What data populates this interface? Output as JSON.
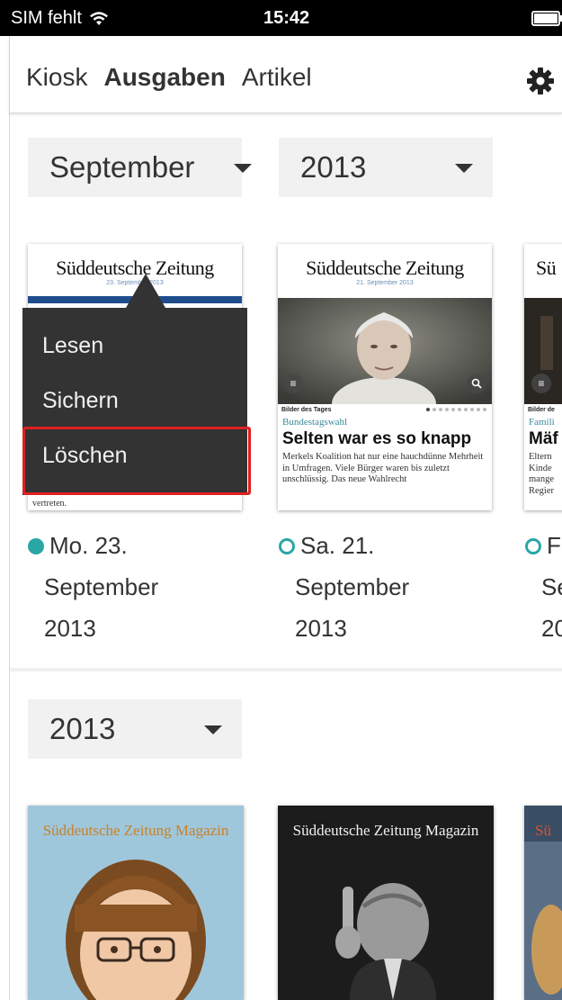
{
  "status_bar": {
    "carrier": "SIM fehlt",
    "time": "15:42"
  },
  "nav": {
    "tabs": [
      {
        "label": "Kiosk",
        "active": false
      },
      {
        "label": "Ausgaben",
        "active": true
      },
      {
        "label": "Artikel",
        "active": false
      }
    ]
  },
  "filters": {
    "month": "September",
    "year": "2013"
  },
  "issues": [
    {
      "masthead": "Süddeutsche Zeitung",
      "date_line": "23. September 2013",
      "weekday_date": "Mo. 23.",
      "month": "September",
      "year": "2013",
      "downloaded": true,
      "visible_text": "vertreten."
    },
    {
      "masthead": "Süddeutsche Zeitung",
      "date_line": "21. September 2013",
      "photo_section": "Bilder des Tages",
      "kicker": "Bundestagswahl",
      "headline": "Selten war es so knapp",
      "body": "Merkels Koalition hat nur eine hauchdünne Mehrheit in Umfragen. Viele Bürger waren bis zuletzt unschlüssig. Das neue Wahlrecht",
      "weekday_date": "Sa. 21.",
      "month": "September",
      "year": "2013",
      "downloaded": false
    },
    {
      "masthead": "Sü",
      "photo_section": "Bilder de",
      "kicker": "Famili",
      "headline": "Mäf",
      "body_lines": [
        "Eltern",
        "Kinde",
        "mange",
        "Regier"
      ],
      "weekday_date": "F",
      "month": "Se",
      "year": "20",
      "downloaded": false
    }
  ],
  "context_menu": {
    "items": [
      "Lesen",
      "Sichern",
      "Löschen"
    ],
    "highlighted": "Löschen"
  },
  "magazine_filter": {
    "year": "2013"
  },
  "magazines": [
    {
      "title": "Süddeutsche Zeitung Magazin"
    },
    {
      "title": "Süddeutsche Zeitung Magazin"
    },
    {
      "title": "Sü"
    }
  ],
  "colors": {
    "accent": "#2aa6a6",
    "menu_bg": "#333333",
    "highlight_border": "#e02020",
    "selector_bg": "#f1f1f1"
  }
}
